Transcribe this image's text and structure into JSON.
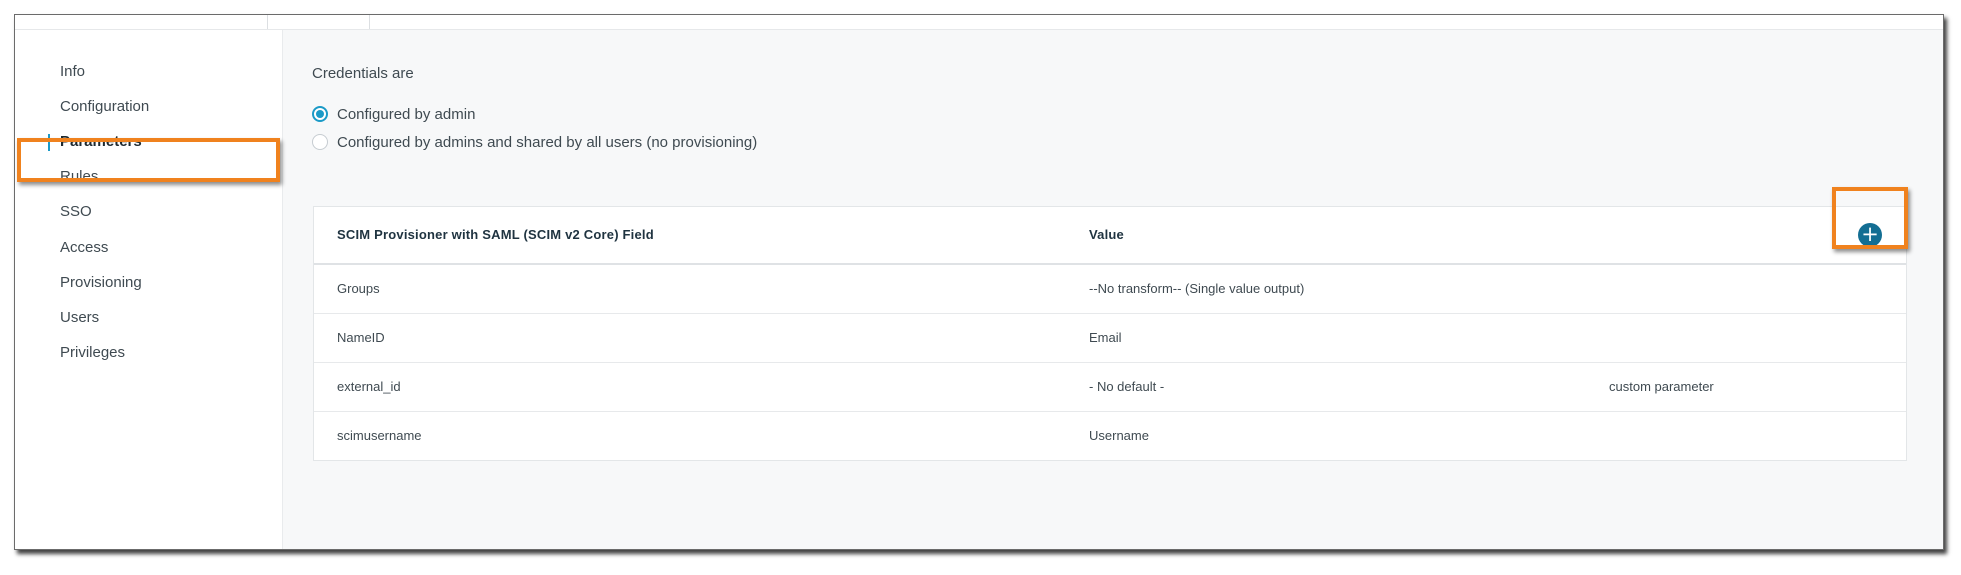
{
  "sidebar": {
    "items": [
      {
        "label": "Info",
        "active": false
      },
      {
        "label": "Configuration",
        "active": false
      },
      {
        "label": "Parameters",
        "active": true
      },
      {
        "label": "Rules",
        "active": false
      },
      {
        "label": "SSO",
        "active": false
      },
      {
        "label": "Access",
        "active": false
      },
      {
        "label": "Provisioning",
        "active": false
      },
      {
        "label": "Users",
        "active": false
      },
      {
        "label": "Privileges",
        "active": false
      }
    ]
  },
  "credentials": {
    "label": "Credentials are",
    "options": [
      {
        "label": "Configured by admin",
        "selected": true
      },
      {
        "label": "Configured by admins and shared by all users (no provisioning)",
        "selected": false
      }
    ]
  },
  "table": {
    "headers": {
      "field": "SCIM Provisioner with SAML (SCIM v2 Core) Field",
      "value": "Value"
    },
    "add_icon": "plus-circle-icon",
    "rows": [
      {
        "field": "Groups",
        "value": "--No transform-- (Single value output)",
        "note": ""
      },
      {
        "field": "NameID",
        "value": "Email",
        "note": ""
      },
      {
        "field": "external_id",
        "value": "- No default -",
        "note": "custom parameter"
      },
      {
        "field": "scimusername",
        "value": "Username",
        "note": ""
      }
    ]
  },
  "colors": {
    "accent": "#1b9ac7",
    "add_button": "#136e93",
    "highlight": "#f0821e"
  }
}
